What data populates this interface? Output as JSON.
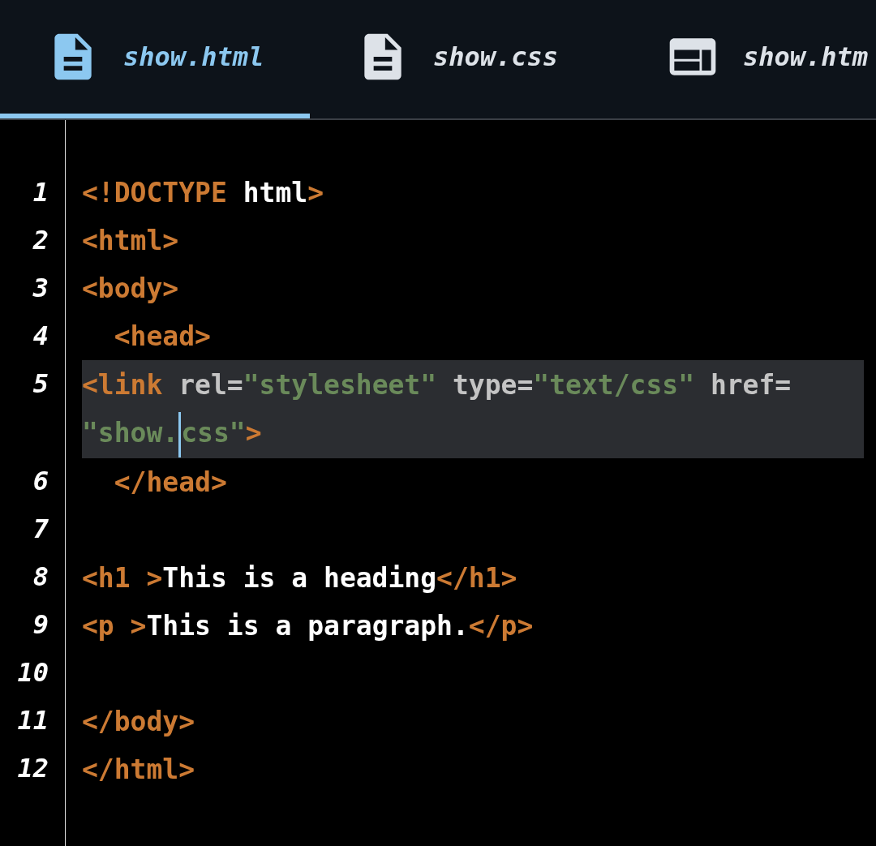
{
  "tabs": [
    {
      "label": "show.html",
      "kind": "file",
      "selected": true
    },
    {
      "label": "show.css",
      "kind": "file",
      "selected": false
    },
    {
      "label": "show.htm",
      "kind": "preview",
      "selected": false
    }
  ],
  "editor": {
    "lines": [
      {
        "number": "1",
        "current": false,
        "tokens": [
          {
            "kind": "tag",
            "text": "<!DOCTYPE"
          },
          {
            "kind": "text",
            "text": " html"
          },
          {
            "kind": "tag",
            "text": ">"
          }
        ]
      },
      {
        "number": "2",
        "current": false,
        "tokens": [
          {
            "kind": "tag",
            "text": "<html>"
          }
        ]
      },
      {
        "number": "3",
        "current": false,
        "tokens": [
          {
            "kind": "tag",
            "text": "<body>"
          }
        ]
      },
      {
        "number": "4",
        "current": false,
        "tokens": [
          {
            "kind": "tag",
            "text": "  <head>"
          }
        ]
      },
      {
        "number": "5",
        "current": true,
        "tokens": [
          {
            "kind": "tag",
            "text": "<link"
          },
          {
            "kind": "attr",
            "text": " rel="
          },
          {
            "kind": "string",
            "text": "\"stylesheet\""
          },
          {
            "kind": "attr",
            "text": " type="
          },
          {
            "kind": "string",
            "text": "\"text/css\" "
          },
          {
            "kind": "attr",
            "text": "href="
          },
          {
            "kind": "string",
            "text": "\"show."
          },
          {
            "kind": "cursor"
          },
          {
            "kind": "string",
            "text": "css\""
          },
          {
            "kind": "tag",
            "text": ">"
          }
        ]
      },
      {
        "number": "6",
        "current": false,
        "tokens": [
          {
            "kind": "tag",
            "text": "  </head>"
          }
        ]
      },
      {
        "number": "7",
        "current": false
      },
      {
        "number": "8",
        "current": false,
        "tokens": [
          {
            "kind": "tag",
            "text": "<h1 >"
          },
          {
            "kind": "text",
            "text": "This is a heading"
          },
          {
            "kind": "tag",
            "text": "</h1>"
          }
        ]
      },
      {
        "number": "9",
        "current": false,
        "tokens": [
          {
            "kind": "tag",
            "text": "<p >"
          },
          {
            "kind": "text",
            "text": "This is a paragraph."
          },
          {
            "kind": "tag",
            "text": "</p>"
          }
        ]
      },
      {
        "number": "10",
        "current": false
      },
      {
        "number": "11",
        "current": false,
        "tokens": [
          {
            "kind": "tag",
            "text": "</body>"
          }
        ]
      },
      {
        "number": "12",
        "current": false,
        "tokens": [
          {
            "kind": "tag",
            "text": "</html>"
          }
        ]
      }
    ]
  }
}
